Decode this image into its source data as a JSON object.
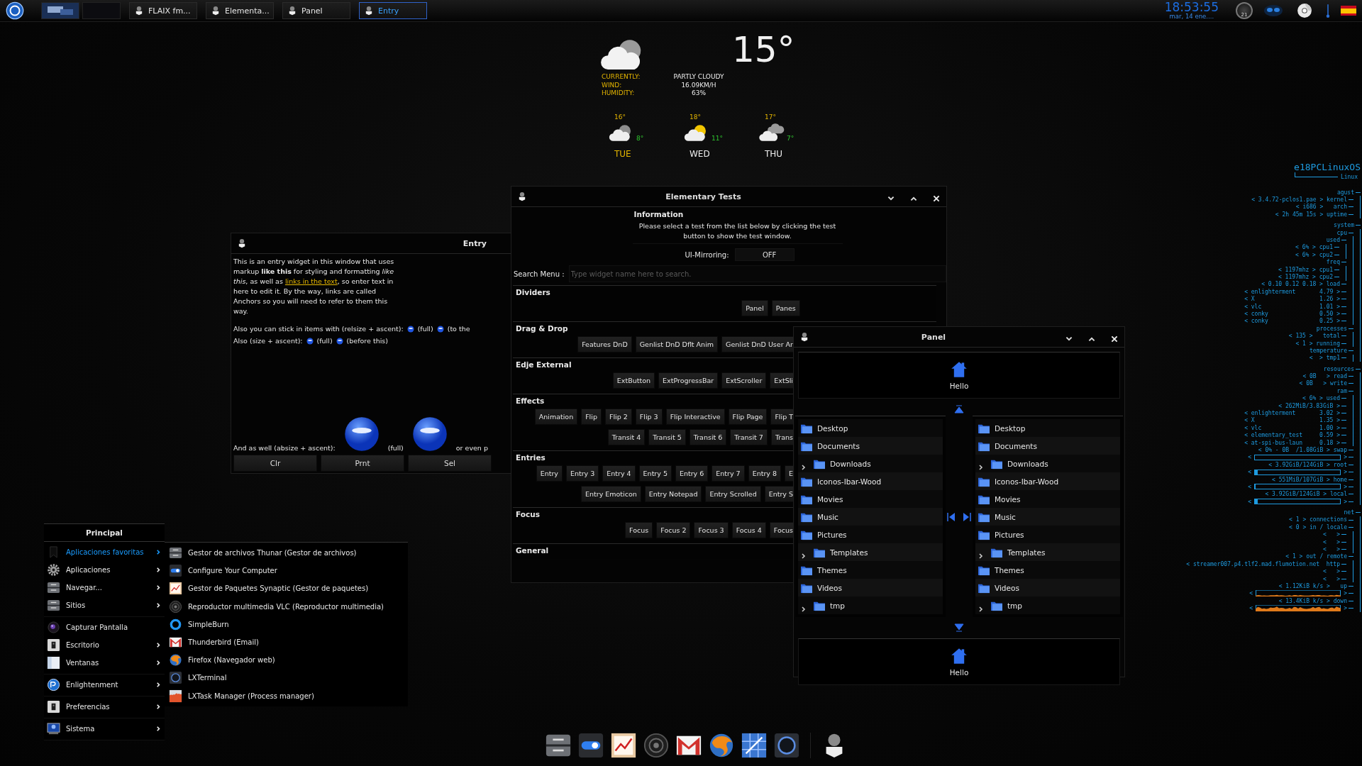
{
  "taskbar": {
    "tasks": [
      {
        "label": "FLAIX fm...",
        "selected": false
      },
      {
        "label": "Elementa...",
        "selected": false
      },
      {
        "label": "Panel",
        "selected": false
      },
      {
        "label": "Entry",
        "selected": true
      }
    ],
    "clock": "18:53:55",
    "date": "mar, 14 ene....",
    "gauge_reading": "21"
  },
  "weather": {
    "temperature": "15°",
    "rows": [
      {
        "label": "CURRENTLY:",
        "value": "PARTLY CLOUDY"
      },
      {
        "label": "WIND:",
        "value": "16.09KM/H"
      },
      {
        "label": "HUMIDITY:",
        "value": "63%"
      }
    ],
    "forecast": [
      {
        "day": "TUE",
        "high": "16°",
        "low": "8°",
        "kind": "cloudy",
        "selected": true
      },
      {
        "day": "WED",
        "high": "18°",
        "low": "11°",
        "kind": "sunny",
        "selected": false
      },
      {
        "day": "THU",
        "high": "17°",
        "low": "7°",
        "kind": "clouds",
        "selected": false
      }
    ]
  },
  "entry_window": {
    "title": "Entry",
    "body": [
      {
        "kind": "text",
        "text": "This is an entry widget in this window that uses markup **like this** for styling and formatting *like this*, as well as "
      },
      {
        "kind": "link",
        "text": "links in the text"
      },
      {
        "kind": "text",
        "text": ", so enter text in here to edit it. By the way, links are called Anchors so you will need to refer to them this way."
      }
    ],
    "lines": [
      [
        {
          "kind": "text",
          "text": "Also you can stick in items with (relsize + ascent):"
        },
        {
          "kind": "emoticon"
        },
        {
          "kind": "text",
          "text": "(full)"
        },
        {
          "kind": "emoticon"
        },
        {
          "kind": "text",
          "text": "(to the"
        }
      ],
      [
        {
          "kind": "text",
          "text": "Also (size + ascent):"
        },
        {
          "kind": "emoticon"
        },
        {
          "kind": "text",
          "text": "(full)"
        },
        {
          "kind": "emoticon"
        },
        {
          "kind": "text",
          "text": "(before this)"
        }
      ],
      [
        {
          "kind": "text",
          "text": "And as well (absize + ascent):"
        },
        {
          "kind": "emoticon-large"
        },
        {
          "kind": "text",
          "text": "(full)"
        },
        {
          "kind": "emoticon-large"
        },
        {
          "kind": "text",
          "text": "or even p"
        }
      ]
    ],
    "buttons": [
      "Clr",
      "Prnt",
      "Sel"
    ]
  },
  "tests_window": {
    "title": "Elementary Tests",
    "info_title": "Information",
    "info_text": "Please select a test from the list below by clicking the test button to show the test window.",
    "mirroring_label": "UI-Mirroring:",
    "mirroring": {
      "on": false,
      "label": "OFF"
    },
    "search_label": "Search Menu :",
    "search_placeholder": "Type widget name here to search.",
    "sections": [
      {
        "title": "Dividers",
        "lines": [
          {
            "buttons": [
              "Panel",
              "Panes"
            ]
          }
        ]
      },
      {
        "title": "Drag & Drop",
        "lines": [
          {
            "buttons": [
              "Features DnD",
              "Genlist DnD Dflt Anim",
              "Genlist DnD User Ar"
            ]
          }
        ]
      },
      {
        "title": "Edje External",
        "lines": [
          {
            "buttons": [
              "ExtButton",
              "ExtProgressBar",
              "ExtScroller",
              "ExtSli"
            ]
          }
        ]
      },
      {
        "title": "Effects",
        "lines": [
          {
            "buttons": [
              "Animation",
              "Flip",
              "Flip 2",
              "Flip 3",
              "Flip Interactive",
              "Flip Page",
              "Flip T"
            ]
          },
          {
            "buttons": [
              "Transit 4",
              "Transit 5",
              "Transit 6",
              "Transit 7",
              "Trans"
            ]
          }
        ]
      },
      {
        "title": "Entries",
        "lines": [
          {
            "buttons": [
              "Entry",
              "Entry 3",
              "Entry 4",
              "Entry 5",
              "Entry 6",
              "Entry 7",
              "Entry 8",
              "E"
            ]
          },
          {
            "buttons": [
              "Entry Emoticon",
              "Entry Notepad",
              "Entry Scrolled",
              "Entry S"
            ]
          }
        ]
      },
      {
        "title": "Focus",
        "lines": [
          {
            "buttons": [
              "Focus",
              "Focus 2",
              "Focus 3",
              "Focus 4",
              "Focus"
            ]
          }
        ]
      },
      {
        "title": "General"
      }
    ]
  },
  "panel_window": {
    "title": "Panel",
    "top_label": "Hello",
    "bottom_label": "Hello",
    "left_list": [
      {
        "label": "Desktop",
        "expandable": false
      },
      {
        "label": "Documents",
        "expandable": false
      },
      {
        "label": "Downloads",
        "expandable": true
      },
      {
        "label": "Iconos-Ibar-Wood",
        "expandable": false
      },
      {
        "label": "Movies",
        "expandable": false
      },
      {
        "label": "Music",
        "expandable": false
      },
      {
        "label": "Pictures",
        "expandable": false
      },
      {
        "label": "Templates",
        "expandable": true
      },
      {
        "label": "Themes",
        "expandable": false
      },
      {
        "label": "Videos",
        "expandable": false
      },
      {
        "label": "tmp",
        "expandable": true
      }
    ],
    "right_list": [
      {
        "label": "Desktop",
        "expandable": false
      },
      {
        "label": "Documents",
        "expandable": false
      },
      {
        "label": "Downloads",
        "expandable": true
      },
      {
        "label": "Iconos-Ibar-Wood",
        "expandable": false
      },
      {
        "label": "Movies",
        "expandable": false
      },
      {
        "label": "Music",
        "expandable": false
      },
      {
        "label": "Pictures",
        "expandable": false
      },
      {
        "label": "Templates",
        "expandable": true
      },
      {
        "label": "Themes",
        "expandable": false
      },
      {
        "label": "Videos",
        "expandable": false
      },
      {
        "label": "tmp",
        "expandable": true
      }
    ]
  },
  "menu": {
    "title": "Principal",
    "groups": [
      [
        {
          "label": "Aplicaciones favoritas",
          "kind": "bookmark",
          "submenu": true,
          "selected": true
        },
        {
          "label": "Aplicaciones",
          "kind": "gear",
          "submenu": true,
          "selected": false
        },
        {
          "label": "Navegar...",
          "kind": "drawer",
          "submenu": true,
          "selected": false
        },
        {
          "label": "Sitios",
          "kind": "drawer",
          "submenu": true,
          "selected": false
        }
      ],
      [
        {
          "label": "Capturar Pantalla",
          "kind": "lens",
          "submenu": false,
          "selected": false
        },
        {
          "label": "Escritorio",
          "kind": "switch",
          "submenu": true,
          "selected": false
        },
        {
          "label": "Ventanas",
          "kind": "window",
          "submenu": true,
          "selected": false
        }
      ],
      [
        {
          "label": "Enlightenment",
          "kind": "logo",
          "submenu": true,
          "selected": false
        }
      ],
      [
        {
          "label": "Preferencias",
          "kind": "switch",
          "submenu": true,
          "selected": false
        }
      ],
      [
        {
          "label": "Sistema",
          "kind": "monitor",
          "submenu": true,
          "selected": false
        }
      ]
    ],
    "submenu": [
      {
        "label": "Gestor de archivos Thunar (Gestor de archivos)",
        "kind": "drawer"
      },
      {
        "label": "Configure Your Computer",
        "kind": "toggle"
      },
      {
        "label": "Gestor de Paquetes Synaptic (Gestor de paquetes)",
        "kind": "chart"
      },
      {
        "label": "Reproductor multimedia VLC (Reproductor multimedia)",
        "kind": "speaker"
      },
      {
        "label": "SimpleBurn",
        "kind": "ring"
      },
      {
        "label": "Thunderbird (Email)",
        "kind": "mail"
      },
      {
        "label": "Firefox (Navegador web)",
        "kind": "fox"
      },
      {
        "label": "LXTerminal",
        "kind": "terminal"
      },
      {
        "label": "LXTask Manager (Process manager)",
        "kind": "bars"
      }
    ]
  },
  "conky": {
    "title": "e18PCLinuxOS",
    "subtitle": "Linux",
    "tree": [
      {
        "text": "agust",
        "children": [
          {
            "text": "< 3.4.72-pclos1.pae > kernel"
          },
          {
            "text": "< i686 >   arch"
          },
          {
            "text": "< 2h 45m 15s > uptime"
          }
        ]
      },
      {
        "text": "system",
        "children": [
          {
            "text": "cpu",
            "children": [
              {
                "text": "used",
                "children": [
                  {
                    "text": "< 6% > cpu1"
                  },
                  {
                    "text": "< 6% > cpu2"
                  }
                ]
              },
              {
                "text": "freq",
                "children": [
                  {
                    "text": "< 1197mhz > cpu1"
                  },
                  {
                    "text": "< 1197mhz > cpu2"
                  }
                ]
              },
              {
                "text": "< 0.10 0.12 0.18 > load"
              },
              {
                "text": "< enlighterment       4.79 >"
              },
              {
                "text": "< X                   1.26 >"
              },
              {
                "text": "< vlc                 1.01 >"
              },
              {
                "text": "< conky               0.50 >"
              },
              {
                "text": "< conky               0.25 >"
              }
            ]
          },
          {
            "text": "processes",
            "children": [
              {
                "text": "< 135 >   total"
              },
              {
                "text": "< 1 > running"
              }
            ]
          },
          {
            "text": "temperature",
            "children": [
              {
                "text": "<  > tmp1"
              }
            ]
          }
        ]
      },
      {
        "text": "resources",
        "children": [
          {
            "text": "< 0B   > read"
          },
          {
            "text": "< 0B   > write"
          },
          {
            "text": "ram",
            "children": [
              {
                "text": "< 6% > used"
              },
              {
                "text": "< 262MiB/3.83GiB >"
              },
              {
                "text": "< enlighterment       3.02 >"
              },
              {
                "text": "< X                   1.35 >"
              },
              {
                "text": "< vlc                 1.00 >"
              },
              {
                "text": "< elementary_test     0.59 >"
              },
              {
                "text": "< at-spi-bus-laun     0.18 >"
              }
            ]
          },
          {
            "text": "< 0% - 0B  /1.08GiB > swap"
          },
          {
            "kind": "bar",
            "level": 0.0,
            "before": "<",
            "after": ">"
          },
          {
            "text": "< 3.92GiB/124GiB > root"
          },
          {
            "kind": "bar",
            "level": 0.03,
            "before": "<",
            "after": ">"
          },
          {
            "text": "< 551MiB/107GiB > home"
          },
          {
            "kind": "bar",
            "level": 0.01,
            "before": "<",
            "after": ">"
          },
          {
            "text": "< 3.92GiB/124GiB > local"
          },
          {
            "kind": "bar",
            "level": 0.03,
            "before": "<",
            "after": ">"
          }
        ]
      },
      {
        "text": "net",
        "children": [
          {
            "text": "< 1 > connections"
          },
          {
            "text": "< 0 > in / locale",
            "children": [
              {
                "text": "<   >"
              },
              {
                "text": "<   >"
              },
              {
                "text": "<   >"
              }
            ]
          },
          {
            "text": "< 1 > out / remote",
            "children": [
              {
                "text": "< streamer007.p4.tlf2.mad.flumotion.net  http"
              },
              {
                "text": "<   >"
              },
              {
                "text": "<   >"
              }
            ]
          },
          {
            "text": "< 1.12KiB k/s >   up"
          },
          {
            "kind": "graph",
            "before": "<",
            "after": ">"
          },
          {
            "text": "< 13.4KiB k/s > down"
          },
          {
            "kind": "graph",
            "before": "<",
            "after": ">"
          }
        ]
      }
    ]
  }
}
